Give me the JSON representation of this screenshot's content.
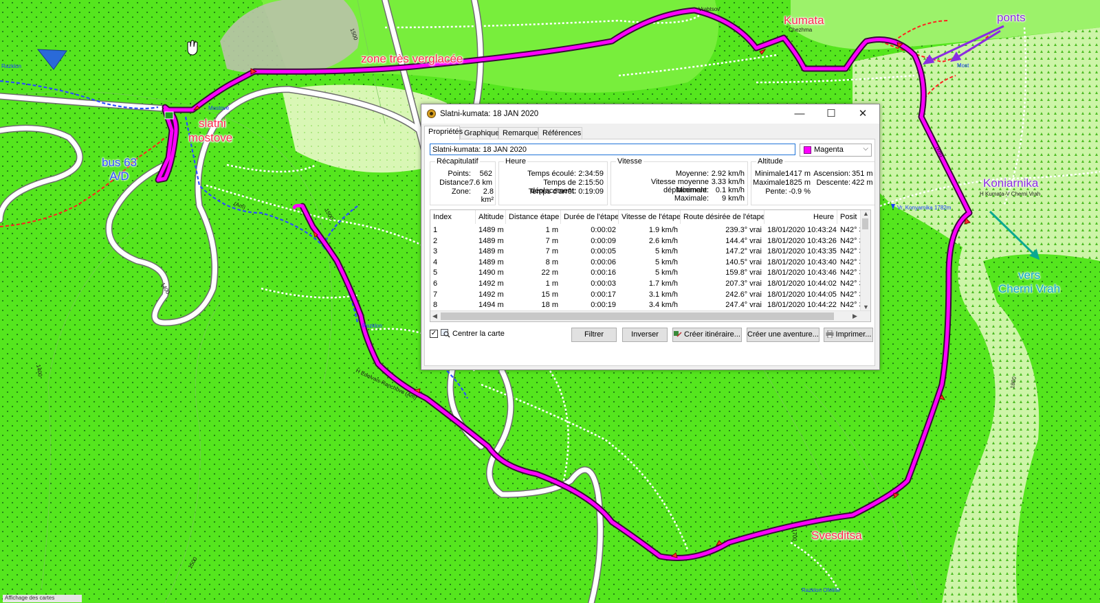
{
  "map": {
    "annotations": {
      "zone": "zone très verglacée",
      "kumata": "Kumata",
      "ponts": "ponts",
      "slatni": "slatni",
      "mostove": "mostove",
      "bus_line1": "bus 63",
      "bus_line2": "A/D",
      "koniarnika": "Koniarnika",
      "vers": "vers",
      "cherni_vrah": "Cherni Vrah",
      "svesditsa": "Svesditsa"
    },
    "small_labels": {
      "mostove": "Mostove",
      "razklon": "Razklon",
      "chezhma": "Chezhma",
      "most": "Most",
      "edelvais": "H Edelvais-Ranchovo (Am)",
      "kumata_chern": "H Kumata-V Cherni Vrah",
      "konyarnika": "Vr. Konyarnika 1782m",
      "razklon_ofeliite": "Razklon Ofeliite",
      "vrabtsov": "Vrabtsov",
      "am": "(Am)",
      "km": "(km)",
      "razklon_left": "Razklon",
      "alt1500a": "1500",
      "alt1500b": "1500",
      "alt1400a": "1400",
      "alt1400b": "1400",
      "alt1700": "1700",
      "alt1500c": "1500",
      "alt1800": "1800",
      "bottom_left": "Affichage des cartes"
    }
  },
  "dialog": {
    "title": "Slatni-kumata: 18 JAN 2020",
    "window_controls": {
      "minimize": "—",
      "maximize": "☐",
      "close": "✕"
    },
    "tabs": [
      "Propriétés",
      "Graphique",
      "Remarques",
      "Références"
    ],
    "name_value": "Slatni-kumata: 18 JAN 2020",
    "color": {
      "label": "Magenta",
      "hex": "#ff00ff"
    },
    "recap": {
      "title": "Récapitulatif",
      "rows": [
        {
          "label": "Points:",
          "value": "562"
        },
        {
          "label": "Distance:",
          "value": "7.6 km"
        },
        {
          "label": "Zone:",
          "value": "2.8 km²"
        }
      ]
    },
    "heure": {
      "title": "Heure",
      "rows": [
        {
          "label": "Temps écoulé:",
          "value": "2:34:59"
        },
        {
          "label": "Temps de déplacement:",
          "value": "2:15:50"
        },
        {
          "label": "Temps d'arrêt:",
          "value": "0:19:09"
        }
      ]
    },
    "vitesse": {
      "title": "Vitesse",
      "rows": [
        {
          "label": "Moyenne:",
          "value": "2.92 km/h"
        },
        {
          "label": "Vitesse moyenne déplacement:",
          "value": "3.33 km/h"
        },
        {
          "label": "Minimale:",
          "value": "0.1 km/h"
        },
        {
          "label": "Maximale:",
          "value": "9 km/h"
        }
      ]
    },
    "altitude": {
      "title": "Altitude",
      "rows": [
        {
          "l1": "Minimale:",
          "v1": "1417 m",
          "l2": "Ascension:",
          "v2": "351 m"
        },
        {
          "l1": "Maximale:",
          "v1": "1825 m",
          "l2": "Descente:",
          "v2": "422 m"
        },
        {
          "l1": "Pente:",
          "v1": "-0.9 %",
          "l2": "",
          "v2": ""
        }
      ]
    },
    "table": {
      "headers": [
        "Index",
        "Altitude",
        "Distance étape",
        "Durée de l'étape",
        "Vitesse de l'étape",
        "Route désirée de l'étape",
        "Heure",
        "Posit"
      ],
      "rows": [
        [
          "1",
          "1489 m",
          "1 m",
          "0:00:02",
          "1.9 km/h",
          "239.3° vrai",
          "18/01/2020 10:43:24",
          "N42° 3"
        ],
        [
          "2",
          "1489 m",
          "7 m",
          "0:00:09",
          "2.6 km/h",
          "144.4° vrai",
          "18/01/2020 10:43:26",
          "N42° 3"
        ],
        [
          "3",
          "1489 m",
          "7 m",
          "0:00:05",
          "5 km/h",
          "147.2° vrai",
          "18/01/2020 10:43:35",
          "N42° 3"
        ],
        [
          "4",
          "1489 m",
          "8 m",
          "0:00:06",
          "5 km/h",
          "140.5° vrai",
          "18/01/2020 10:43:40",
          "N42° 3"
        ],
        [
          "5",
          "1490 m",
          "22 m",
          "0:00:16",
          "5 km/h",
          "159.8° vrai",
          "18/01/2020 10:43:46",
          "N42° 3"
        ],
        [
          "6",
          "1492 m",
          "1 m",
          "0:00:03",
          "1.7 km/h",
          "207.3° vrai",
          "18/01/2020 10:44:02",
          "N42° 3"
        ],
        [
          "7",
          "1492 m",
          "15 m",
          "0:00:17",
          "3.1 km/h",
          "242.6° vrai",
          "18/01/2020 10:44:05",
          "N42° 3"
        ],
        [
          "8",
          "1494 m",
          "18 m",
          "0:00:19",
          "3.4 km/h",
          "247.4° vrai",
          "18/01/2020 10:44:22",
          "N42° 3"
        ]
      ]
    },
    "center_map": {
      "label": "Centrer la carte",
      "checked": "✓"
    },
    "buttons": {
      "filter": "Filtrer",
      "invert": "Inverser",
      "create_route": "Créer itinéraire...",
      "create_adventure": "Créer une aventure...",
      "print": "Imprimer..."
    }
  }
}
